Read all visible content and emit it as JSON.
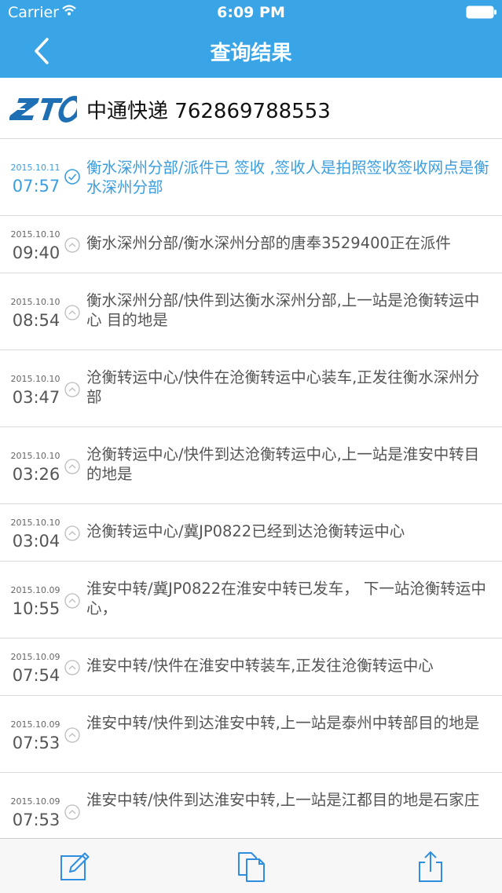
{
  "status_bar": {
    "carrier": "Carrier",
    "time": "6:09 PM"
  },
  "nav": {
    "title": "查询结果",
    "back_icon": "chevron-left-icon"
  },
  "header": {
    "logo_text": "ZTO",
    "company": "中通快递",
    "tracking_number": "762869788553"
  },
  "colors": {
    "nav_bar": "#3aa5e6",
    "active_text": "#3a9ee0",
    "normal_text": "#555555"
  },
  "events": [
    {
      "date": "2015.10.11",
      "time": "07:57",
      "text": "衡水深州分部/派件已 签收 ,签收人是拍照签收签收网点是衡水深州分部",
      "status": "signed"
    },
    {
      "date": "2015.10.10",
      "time": "09:40",
      "text": "衡水深州分部/衡水深州分部的唐奉3529400正在派件"
    },
    {
      "date": "2015.10.10",
      "time": "08:54",
      "text": "衡水深州分部/快件到达衡水深州分部,上一站是沧衡转运中心 目的地是"
    },
    {
      "date": "2015.10.10",
      "time": "03:47",
      "text": "沧衡转运中心/快件在沧衡转运中心装车,正发往衡水深州分部"
    },
    {
      "date": "2015.10.10",
      "time": "03:26",
      "text": "沧衡转运中心/快件到达沧衡转运中心,上一站是淮安中转目的地是"
    },
    {
      "date": "2015.10.10",
      "time": "03:04",
      "text": "沧衡转运中心/冀JP0822已经到达沧衡转运中心"
    },
    {
      "date": "2015.10.09",
      "time": "10:55",
      "text": "淮安中转/冀JP0822在淮安中转已发车， 下一站沧衡转运中心，"
    },
    {
      "date": "2015.10.09",
      "time": "07:54",
      "text": "淮安中转/快件在淮安中转装车,正发往沧衡转运中心"
    },
    {
      "date": "2015.10.09",
      "time": "07:53",
      "text": "淮安中转/快件到达淮安中转,上一站是泰州中转部目的地是"
    },
    {
      "date": "2015.10.09",
      "time": "07:53",
      "text": "淮安中转/快件到达淮安中转,上一站是江都目的地是石家庄"
    }
  ],
  "toolbar": {
    "icons": [
      "compose-icon",
      "copy-icon",
      "share-icon"
    ]
  }
}
